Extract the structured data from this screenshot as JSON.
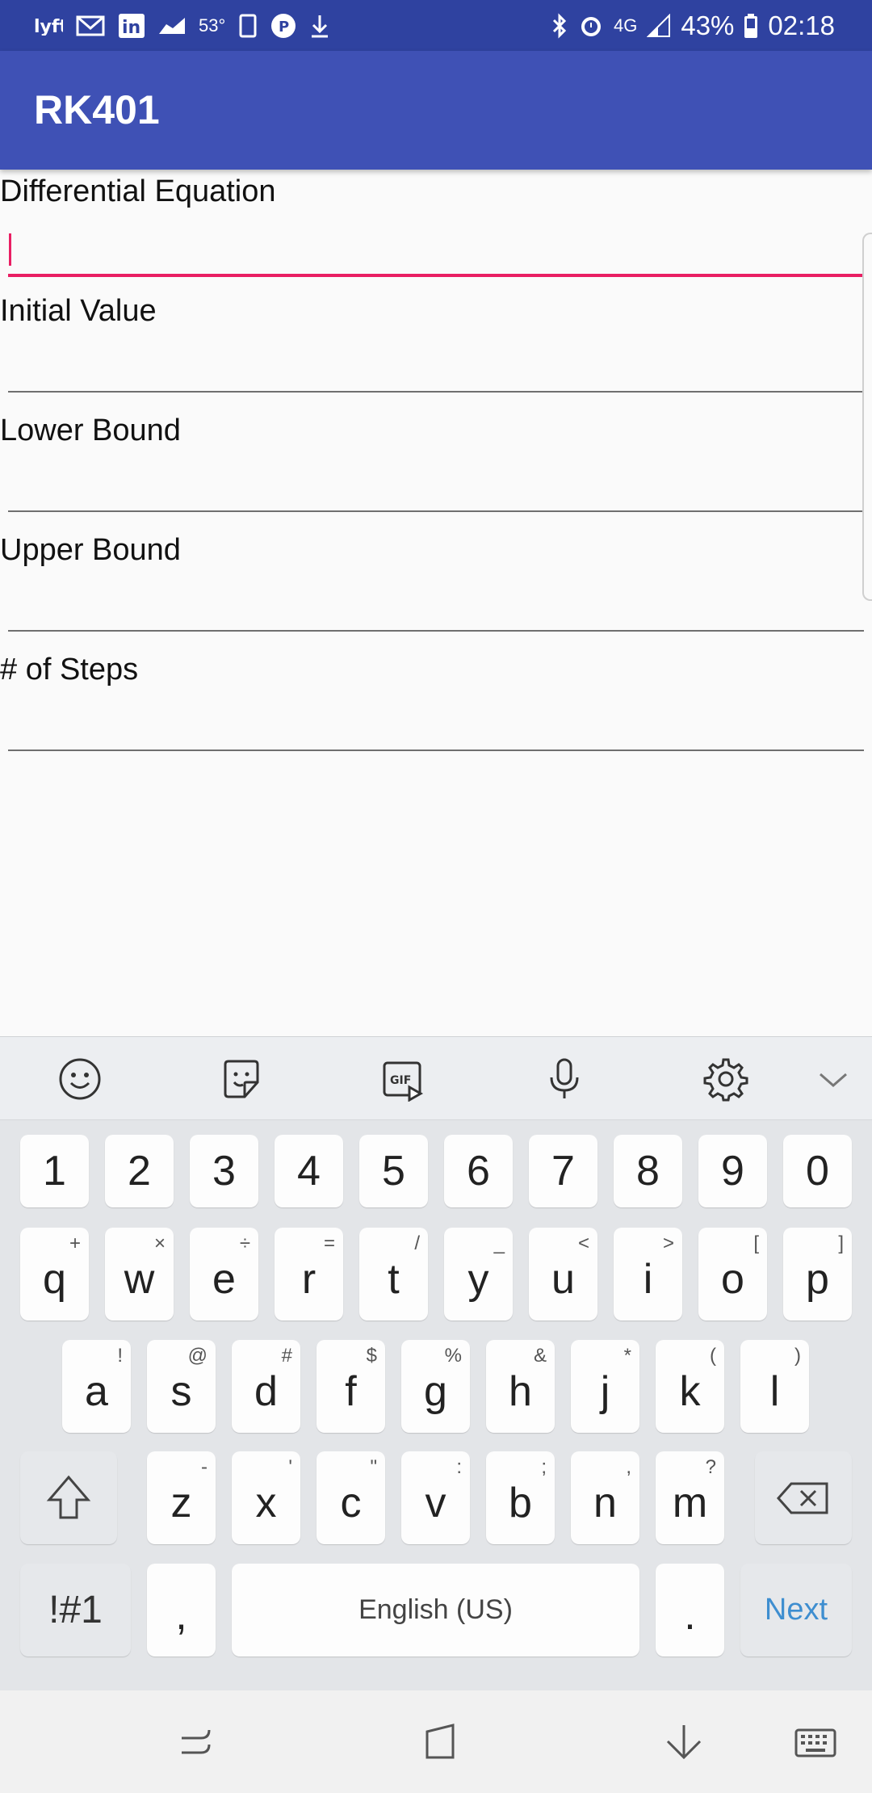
{
  "status_bar": {
    "temperature": "53°",
    "battery": "43%",
    "time": "02:18",
    "network": "4G",
    "left_icons": [
      "lyft-icon",
      "gmail-icon",
      "linkedin-icon",
      "chart-icon",
      "notes-icon",
      "pandora-icon",
      "download-icon"
    ],
    "right_icons": [
      "bluetooth-icon",
      "alarm-icon",
      "signal-icon",
      "battery-icon"
    ]
  },
  "app_bar": {
    "title": "RK401",
    "color": "#3f51b5"
  },
  "form": {
    "fields": [
      {
        "label": "Differential Equation",
        "value": "",
        "focused": true
      },
      {
        "label": "Initial Value",
        "value": ""
      },
      {
        "label": "Lower Bound",
        "value": ""
      },
      {
        "label": "Upper Bound",
        "value": ""
      },
      {
        "label": "# of Steps",
        "value": ""
      }
    ],
    "accent": "#e91e63"
  },
  "keyboard": {
    "toolbar": [
      "emoji-icon",
      "sticker-icon",
      "gif-icon",
      "microphone-icon",
      "settings-icon",
      "collapse-icon"
    ],
    "number_row": [
      "1",
      "2",
      "3",
      "4",
      "5",
      "6",
      "7",
      "8",
      "9",
      "0"
    ],
    "row1": {
      "keys": [
        "q",
        "w",
        "e",
        "r",
        "t",
        "y",
        "u",
        "i",
        "o",
        "p"
      ],
      "alts": [
        "+",
        "×",
        "÷",
        "=",
        "/",
        "_",
        "<",
        ">",
        "[",
        "]"
      ]
    },
    "row2": {
      "keys": [
        "a",
        "s",
        "d",
        "f",
        "g",
        "h",
        "j",
        "k",
        "l"
      ],
      "alts": [
        "!",
        "@",
        "#",
        "$",
        "%",
        "&",
        "*",
        "(",
        ")"
      ]
    },
    "row3": {
      "keys": [
        "z",
        "x",
        "c",
        "v",
        "b",
        "n",
        "m"
      ],
      "alts": [
        "-",
        "'",
        "\"",
        ":",
        ";",
        ",",
        "?"
      ]
    },
    "symbols_label": "!#1",
    "comma_label": ",",
    "space_label": "English (US)",
    "period_label": ".",
    "action_label": "Next"
  },
  "nav_bar": [
    "recents-icon",
    "home-icon",
    "back-icon",
    "keyboard-icon"
  ]
}
